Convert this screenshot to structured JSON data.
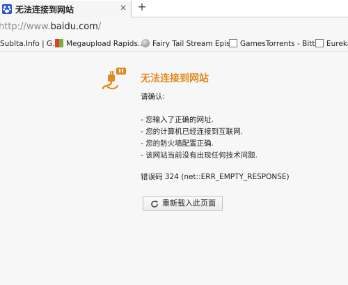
{
  "tab": {
    "title": "无法连接到网站",
    "close_glyph": "×",
    "favicon": "baidu-paw-icon"
  },
  "new_tab_glyph": "+",
  "address": {
    "scheme": "http://www.",
    "host": "baidu.com",
    "path": "/"
  },
  "bookmarks": [
    {
      "label": "SubIta.Info | G...",
      "icon": "none"
    },
    {
      "label": "Megaupload Rapids...",
      "icon": "windows-icon"
    },
    {
      "label": "Fairy Tail Stream Epis...",
      "icon": "globe-icon"
    },
    {
      "label": "GamesTorrents - Bitt...",
      "icon": "document-icon"
    },
    {
      "label": "Eureka",
      "icon": "document-icon"
    }
  ],
  "error": {
    "title": "无法连接到网站",
    "confirm": "请确认:",
    "checks": [
      "- 您输入了正确的网址.",
      "- 您的计算机已经连接到互联网.",
      "- 您的防火墙配置正确.",
      "- 该网站当前没有出现任何技术问题."
    ],
    "code": "错误码 324 (net::ERR_EMPTY_RESPONSE)",
    "reload_label": "重新载入此页面"
  },
  "colors": {
    "accent_orange": "#e08a1e",
    "favicon_blue": "#2a55c8"
  }
}
